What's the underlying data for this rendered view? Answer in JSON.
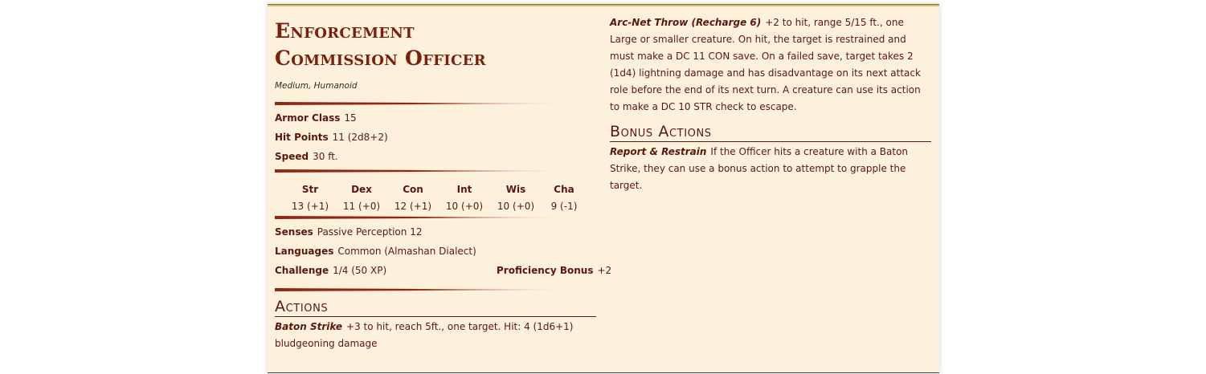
{
  "monster": {
    "name_line1": "Enforcement",
    "name_line2": "Commission Officer",
    "subtype": "Medium, Humanoid"
  },
  "core": {
    "armor_class": {
      "label": "Armor Class",
      "value": "15"
    },
    "hit_points": {
      "label": "Hit Points",
      "value": "11 (2d8+2)"
    },
    "speed": {
      "label": "Speed",
      "value": "30 ft."
    }
  },
  "abilities": [
    {
      "name": "Str",
      "score": "13 (+1)"
    },
    {
      "name": "Dex",
      "score": "11 (+0)"
    },
    {
      "name": "Con",
      "score": "12 (+1)"
    },
    {
      "name": "Int",
      "score": "10 (+0)"
    },
    {
      "name": "Wis",
      "score": "10 (+0)"
    },
    {
      "name": "Cha",
      "score": "9 (-1)"
    }
  ],
  "details": {
    "senses": {
      "label": "Senses",
      "value": "Passive Perception 12"
    },
    "languages": {
      "label": "Languages",
      "value": "Common (Almashan Dialect)"
    },
    "challenge": {
      "label": "Challenge",
      "value": "1/4 (50 XP)"
    },
    "proficiency": {
      "label": "Proficiency Bonus",
      "value": "+2"
    }
  },
  "actions": {
    "title": "Actions",
    "items": [
      {
        "name": "Baton Strike",
        "text": "+3 to hit, reach 5ft., one target. Hit: 4 (1d6+1) bludgeoning damage"
      },
      {
        "name": "Arc-Net Throw (Recharge 6)",
        "text": "+2 to hit, range 5/15 ft., one Large or smaller creature. On hit, the target is restrained and must make a DC 11 CON save. On a failed save, target takes 2 (1d4) lightning damage and has disadvantage on its next attack role before the end of its next turn. A creature can use its action to make a DC 10 STR check to escape."
      }
    ]
  },
  "bonus_actions": {
    "title": "Bonus Actions",
    "items": [
      {
        "name": "Report & Restrain",
        "text": "If the Officer hits a creature with a Baton Strike, they can use a bonus action to attempt to grapple the target."
      }
    ]
  },
  "colors": {
    "accent": "#7a200d",
    "text": "#58180d",
    "parchment": "#fdf1dc",
    "rule": "#922610"
  }
}
